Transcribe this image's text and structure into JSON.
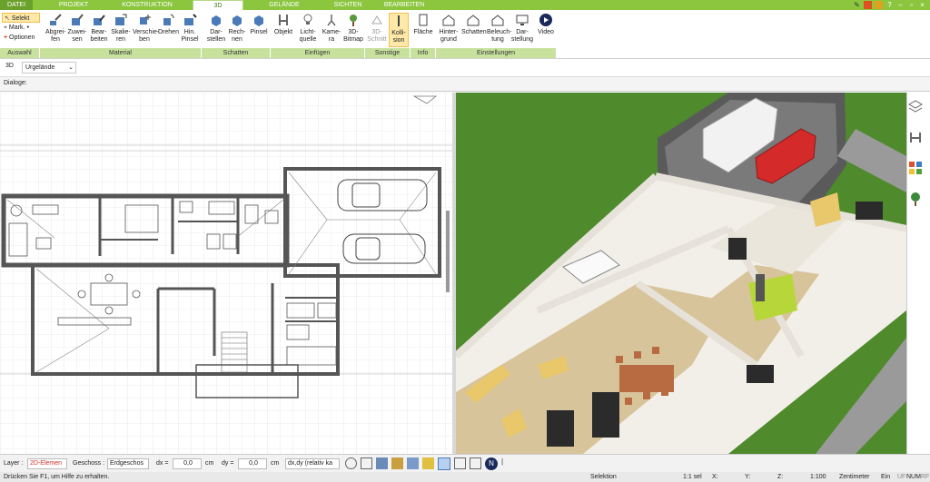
{
  "menu_tabs": [
    "DATEI",
    "PROJEKT",
    "KONSTRUKTION",
    "3D",
    "GELÄNDE",
    "SICHTEN",
    "BEARBEITEN"
  ],
  "selection": {
    "selekt": "Selekt",
    "mark": "Mark.",
    "optionen": "Optionen"
  },
  "ribbon": {
    "abgreifen": "Abgrei-\nfen",
    "zuweisen": "Zuwei-\nsen",
    "bearbeiten": "Bear-\nbeiten",
    "skalieren": "Skalie-\nren",
    "verschieben": "Verschie-\nben",
    "drehen": "Drehen",
    "hin_pinsel": "Hin.\nPinsel",
    "darstellen": "Dar-\nstellen",
    "rechnen": "Rech-\nnen",
    "pinsel": "Pinsel",
    "objekt": "Objekt",
    "lichtquelle": "Licht-\nquelle",
    "kamera": "Kame-\nra",
    "bitmap": "3D-\nBitmap",
    "schnitt": "3D-\nSchnitt",
    "kollision": "Kolli-\nsion",
    "flaeche": "Fläche",
    "hintergrund": "Hinter-\ngrund",
    "schatten": "Schatten",
    "beleuchtung": "Beleuch-\ntung",
    "darstellung": "Dar-\nstellung",
    "video": "Video"
  },
  "groups": {
    "auswahl": "Auswahl",
    "material": "Material",
    "schatten": "Schatten",
    "einfuegen": "Einfügen",
    "sonstige": "Sonstige",
    "info": "Info",
    "einstellungen": "Einstellungen"
  },
  "options": {
    "mode": "3D",
    "terrain": "Urgelände",
    "dialoge": "Dialoge:"
  },
  "bottom": {
    "layer_label": "Layer :",
    "layer_value": "2D-Elemen",
    "geschoss_label": "Geschoss :",
    "geschoss_value": "Erdgeschos",
    "dx_label": "dx =",
    "dx_value": "0,0",
    "dx_unit": "cm",
    "dy_label": "dy =",
    "dy_value": "0,0",
    "dy_unit": "cm",
    "mode_value": "dx,dy (relativ ka"
  },
  "status": {
    "help": "Drücken Sie F1, um Hilfe zu erhalten.",
    "selektion": "Selektion",
    "sel": "1:1 sel",
    "x": "X:",
    "y": "Y:",
    "z": "Z:",
    "scale": "1:100",
    "unit": "Zentimeter",
    "ein": "Ein",
    "uf": "UF",
    "num": "NUM",
    "rf": "RF"
  },
  "colors": {
    "accent": "#8cc63f",
    "group": "#c8e29e",
    "highlight": "#ffe9a8",
    "grass": "#4f8a2c",
    "floor": "#d8c49a"
  }
}
